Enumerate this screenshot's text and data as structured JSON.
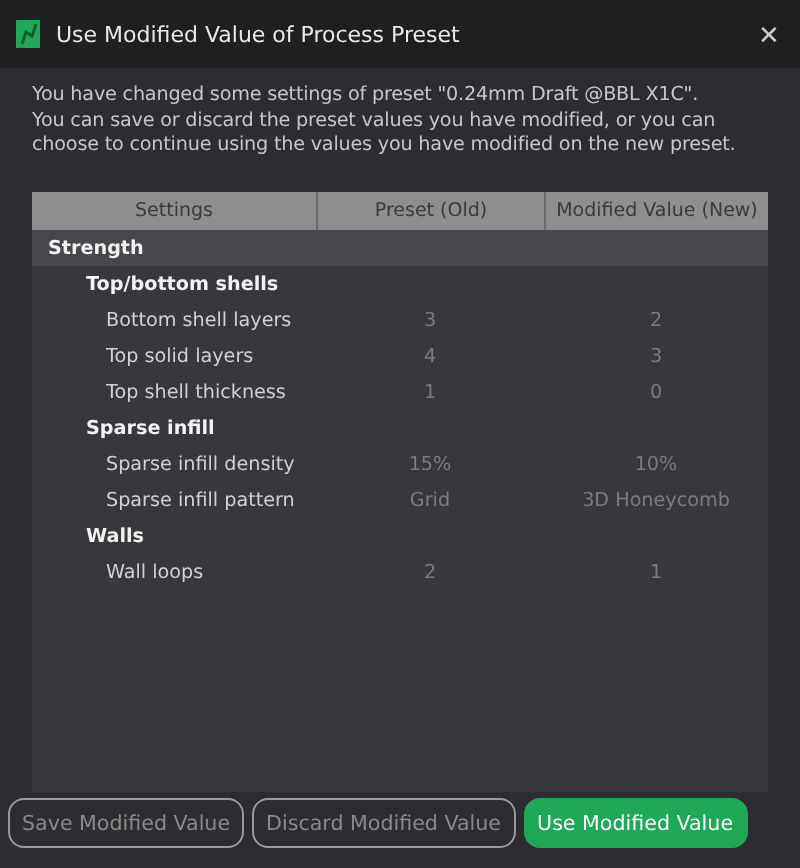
{
  "window": {
    "title": "Use Modified Value of Process Preset",
    "close": "✕"
  },
  "message": [
    "You have changed some settings of preset \"0.24mm Draft @BBL X1C\".",
    "You can save or discard the preset values you have modified, or you can choose to continue using the values you have modified on the new preset."
  ],
  "table": {
    "columns": [
      "Settings",
      "Preset (Old)",
      "Modified Value (New)"
    ],
    "categories": [
      {
        "name": "Strength",
        "children": [
          {
            "name": "Top/bottom shells",
            "children": [
              {
                "name": "Bottom shell layers",
                "old": "3",
                "new": "2"
              },
              {
                "name": "Top solid layers",
                "old": "4",
                "new": "3"
              },
              {
                "name": "Top shell thickness",
                "old": "1",
                "new": "0"
              }
            ]
          },
          {
            "name": "Sparse infill",
            "children": [
              {
                "name": "Sparse infill density",
                "old": "15%",
                "new": "10%"
              },
              {
                "name": "Sparse infill pattern",
                "old": "Grid",
                "new": "3D Honeycomb"
              }
            ]
          },
          {
            "name": "Walls",
            "children": [
              {
                "name": "Wall loops",
                "old": "2",
                "new": "1"
              }
            ]
          }
        ]
      }
    ]
  },
  "buttons": [
    {
      "label": "Save Modified Value",
      "kind": "outline"
    },
    {
      "label": "Discard Modified Value",
      "kind": "outline"
    },
    {
      "label": "Use Modified Value",
      "kind": "primary"
    }
  ]
}
